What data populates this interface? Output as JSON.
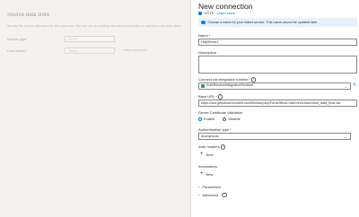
{
  "background": {
    "title": "Source data store",
    "description": "Specify the source data store for the copy task. You can use an existing data store connection or specify a new data store.",
    "source_type_label": "Source type",
    "source_type_value": "HTTP",
    "connection_label": "Connection *",
    "connection_placeholder": "Select...",
    "new_connection_link": "New connection"
  },
  "panel": {
    "title": "New connection",
    "connector_type": "HTTP",
    "learn_more": "Learn more",
    "info_text": "Choose a name for your linked service. This name cannot be updated later.",
    "name": {
      "label": "Name",
      "value": "HttpServer1"
    },
    "description": {
      "label": "Description",
      "value": ""
    },
    "integration_runtime": {
      "label": "Connect via integration runtime",
      "value": "AutoResolveIntegrationRuntime"
    },
    "base_url": {
      "label": "Base URL",
      "value": "https://raw.githubusercontent.com/BethanyJep/TomsOfficeCoise/mnCreator/indo_data_final.csv"
    },
    "cert_validation": {
      "label": "Server Certificate Validation",
      "options": [
        "Enable",
        "Disable"
      ],
      "selected": "Enable"
    },
    "auth_type": {
      "label": "Authentication type",
      "value": "Anonymous"
    },
    "auth_headers": {
      "label": "Auth headers",
      "add_label": "New"
    },
    "annotations": {
      "label": "Annotations",
      "add_label": "New"
    },
    "parameters_label": "Parameters",
    "advanced_label": "Advanced"
  },
  "colors": {
    "accent": "#0078d4",
    "info_bg": "#e8f1fb",
    "required": "#a4262c"
  },
  "icons": [
    "info-icon",
    "chevron-down-icon",
    "edit-icon",
    "plus-icon",
    "chevron-right-icon",
    "integration-runtime-icon"
  ]
}
